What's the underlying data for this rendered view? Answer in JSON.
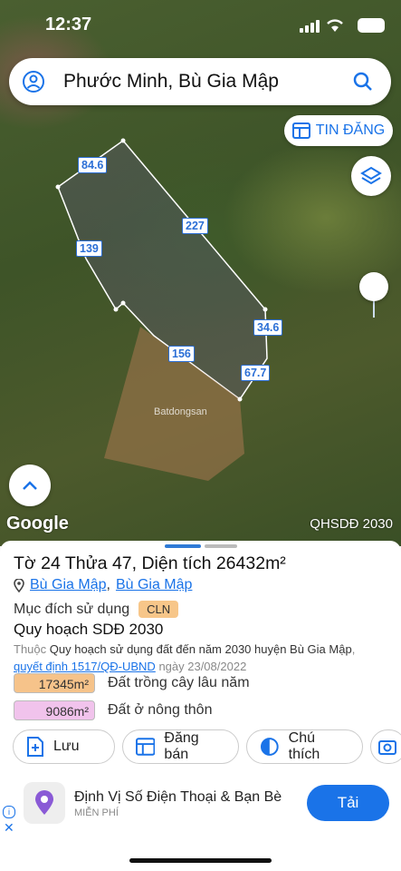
{
  "status": {
    "time": "12:37"
  },
  "search": {
    "query": "Phước Minh, Bù Gia Mập"
  },
  "map": {
    "tin_dang_label": "TIN ĐĂNG",
    "google_label": "Google",
    "layer_label": "QHSDĐ 2030",
    "watermark": "Batdongsan",
    "edges": [
      "84.6",
      "227",
      "139",
      "34.6",
      "156",
      "67.7"
    ]
  },
  "parcel": {
    "title": "Tờ 24 Thửa 47, Diện tích 26432m²",
    "district": "Bù Gia Mập",
    "separator": ",",
    "commune": "Bù Gia Mập",
    "purpose_label": "Mục đích sử dụng",
    "purpose_code": "CLN",
    "plan_title": "Quy hoạch SDĐ 2030",
    "note_prefix": "Thuộc",
    "note_value": "Quy hoạch sử dụng đất đến năm 2030 huyện Bù Gia Mập",
    "note_comma": ",",
    "note_link": "quyết định 1517/QĐ-UBND",
    "note_suffix": "ngày 23/08/2022",
    "areas": [
      {
        "area": "17345m²",
        "label": "Đất trồng cây lâu năm",
        "color": "#f6c38a"
      },
      {
        "area": "9086m²",
        "label": "Đất ở nông thôn",
        "color": "#f1c3ec"
      }
    ]
  },
  "actions": {
    "save": "Lưu",
    "sell": "Đăng bán",
    "legend": "Chú thích"
  },
  "ad": {
    "title": "Định Vị Số Điện Thoại & Bạn Bè",
    "subtitle": "MIỄN PHÍ",
    "cta": "Tải"
  }
}
